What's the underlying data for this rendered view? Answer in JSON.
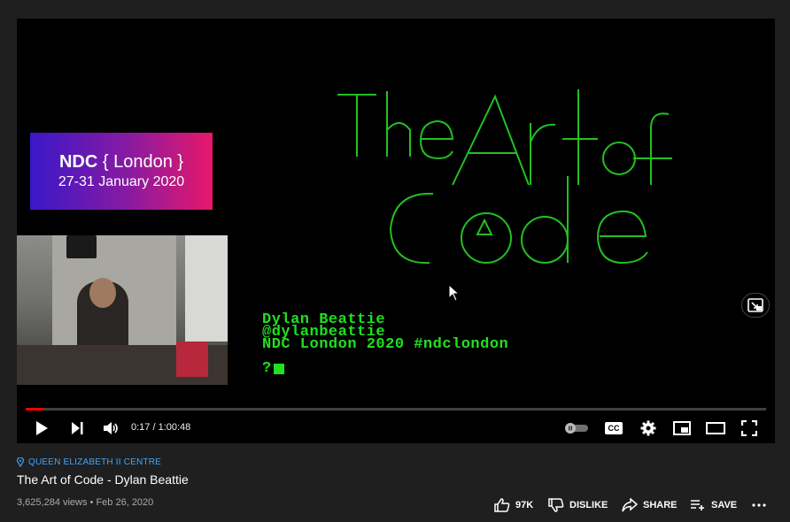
{
  "video": {
    "ndc_brand": "NDC",
    "ndc_event": "{ London }",
    "ndc_dates": "27-31 January 2020",
    "terminal_lines": [
      "Dylan Beattie",
      "@dylanbeattie",
      "NDC London 2020 #ndclondon"
    ],
    "terminal_prompt": "?",
    "art_title_line1": "TheArt of",
    "art_title_line2": "Code"
  },
  "player": {
    "current_time": "0:17",
    "duration": "1:00:48",
    "time_display": "0:17 / 1:00:48",
    "progress_fraction": 0.024,
    "accent": "#ff0000",
    "controls": [
      "play-icon",
      "next-icon",
      "volume-icon",
      "autoplay-toggle",
      "captions-icon",
      "settings-icon",
      "miniplayer-icon",
      "theater-icon",
      "fullscreen-icon"
    ],
    "cc_label": "CC"
  },
  "info": {
    "location": "QUEEN ELIZABETH II CENTRE",
    "title": "The Art of Code - Dylan Beattie",
    "meta": "3,625,284 views • Feb 26, 2020",
    "like_count": "97K",
    "dislike_label": "DISLIKE",
    "share_label": "SHARE",
    "save_label": "SAVE",
    "link_color": "#3ea6ff"
  }
}
